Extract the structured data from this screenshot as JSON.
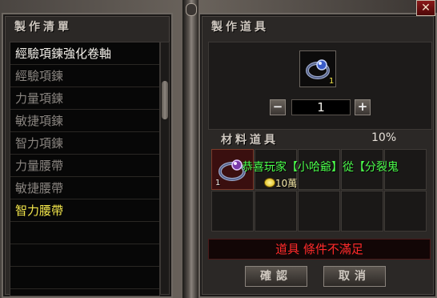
{
  "left_panel": {
    "title": "製作清單",
    "items": [
      {
        "label": "經驗項鍊強化卷軸",
        "state": "bright"
      },
      {
        "label": "經驗項鍊",
        "state": "dim"
      },
      {
        "label": "力量項鍊",
        "state": "dim"
      },
      {
        "label": "敏捷項鍊",
        "state": "dim"
      },
      {
        "label": "智力項鍊",
        "state": "dim"
      },
      {
        "label": "力量腰帶",
        "state": "dim"
      },
      {
        "label": "敏捷腰帶",
        "state": "dim"
      },
      {
        "label": "智力腰帶",
        "state": "selected"
      },
      {
        "label": "",
        "state": "empty"
      },
      {
        "label": "",
        "state": "empty"
      },
      {
        "label": "",
        "state": "empty"
      }
    ]
  },
  "right_panel": {
    "title": "製作道具",
    "product": {
      "icon": "ring-icon",
      "count": "1"
    },
    "quantity": {
      "minus": "−",
      "value": "1",
      "plus": "+"
    },
    "materials": {
      "title": "材料道具",
      "percent": "10%",
      "slot1_count": "1"
    },
    "status": "道具 條件不滿足",
    "buttons": {
      "confirm": "確認",
      "cancel": "取消"
    },
    "close": "✕"
  },
  "overlay": {
    "chat_message": "恭喜玩家【小哈爺】從【分裂鬼",
    "coin_label": "10萬"
  },
  "colors": {
    "selected": "#f4e74b",
    "status": "#ff2a2a",
    "chat": "#4cff4c"
  }
}
